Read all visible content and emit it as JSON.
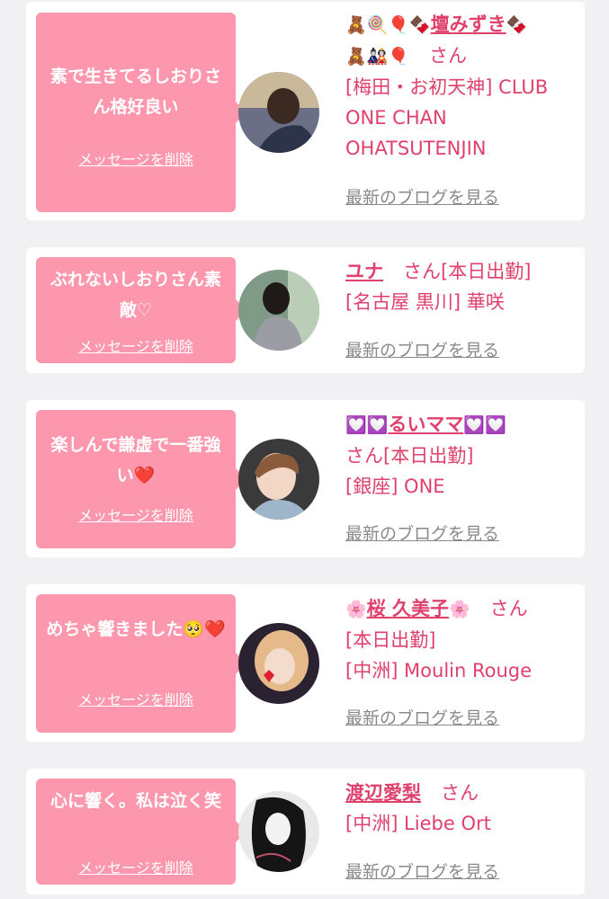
{
  "delete_label": "メッセージを削除",
  "blog_label": "最新のブログを見る",
  "colors": {
    "accent": "#fd97ad",
    "name": "#e0406c",
    "link_gray": "#8a8a8a"
  },
  "cards": [
    {
      "message": "素で生きてるしおりさん格好良い",
      "name_emoji_pre": "🧸🍭🎈🍫",
      "name": "壇みずき",
      "name_emoji_post": "🍫",
      "name_emoji_line2": "🧸🎎🎈",
      "san": "さん",
      "status": "",
      "location": "[梅田・お初天神] CLUB ONE CHAN OHATSUTENJIN"
    },
    {
      "message": "ぶれないしおりさん素敵♡",
      "name": "ユナ",
      "san": "さん",
      "status": "[本日出勤]",
      "location": "[名古屋 黒川] 華咲"
    },
    {
      "message": "楽しんで謙虚で一番強い❤️",
      "name_emoji_pre": "💟💟",
      "name": "るいママ",
      "name_emoji_post": "💟💟",
      "san": "さん",
      "status": "[本日出勤]",
      "location": "[銀座] ONE"
    },
    {
      "message": "めちゃ響きました🥺❤️",
      "name_emoji_pre": "🌸",
      "name": "桜 久美子",
      "name_emoji_post": "🌸",
      "san": "さん",
      "status": "[本日出勤]",
      "location": "[中洲] Moulin Rouge"
    },
    {
      "message": "心に響く。私は泣く笑",
      "name": "渡辺愛梨",
      "san": "さん",
      "status": "",
      "location": "[中洲] Liebe Ort"
    }
  ]
}
